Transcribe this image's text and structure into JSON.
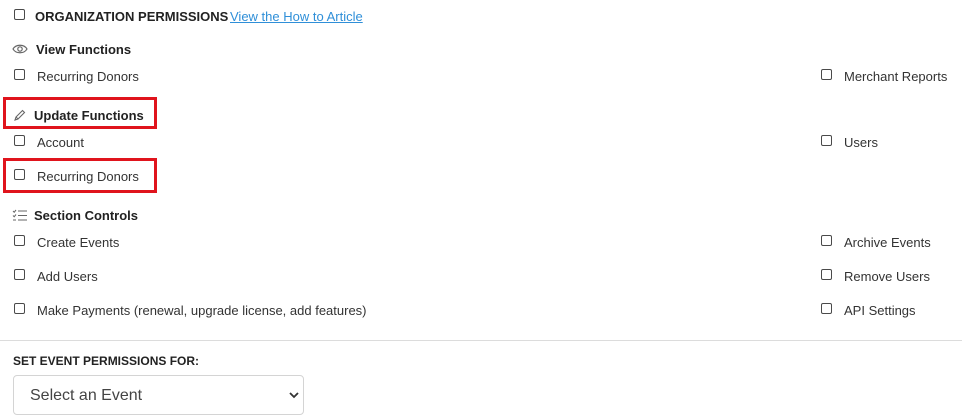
{
  "org": {
    "title": "ORGANIZATION PERMISSIONS",
    "how_to_link": "View the How to Article"
  },
  "view_functions": {
    "title": "View Functions",
    "icon": "eye-icon",
    "left": [
      "Recurring Donors"
    ],
    "right": [
      "Merchant Reports"
    ]
  },
  "update_functions": {
    "title": "Update Functions",
    "icon": "pencil-icon",
    "left": [
      "Account",
      "Recurring Donors"
    ],
    "right": [
      "Users"
    ]
  },
  "section_controls": {
    "title": "Section Controls",
    "icon": "checklist-icon",
    "left": [
      "Create Events",
      "Add Users",
      "Make Payments (renewal, upgrade license, add features)"
    ],
    "right": [
      "Archive Events",
      "Remove Users",
      "API Settings"
    ]
  },
  "event_permissions": {
    "title": "SET EVENT PERMISSIONS FOR:",
    "select_value": "Select an Event"
  },
  "colors": {
    "highlight": "#e0141d",
    "link": "#2f8fd8"
  }
}
